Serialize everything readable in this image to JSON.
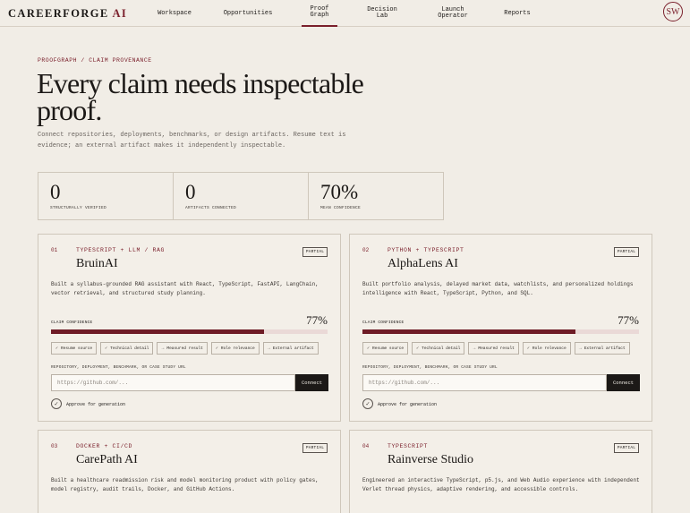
{
  "brand": {
    "name": "CAREERFORGE",
    "suffix": "AI"
  },
  "nav": {
    "items": [
      {
        "label": "Workspace",
        "active": false
      },
      {
        "label": "Opportunities",
        "active": false
      },
      {
        "label": "Proof\nGraph",
        "active": true
      },
      {
        "label": "Decision\nLab",
        "active": false
      },
      {
        "label": "Launch\nOperator",
        "active": false
      },
      {
        "label": "Reports",
        "active": false
      }
    ],
    "avatar": "SW"
  },
  "header": {
    "eyebrow": "PROOFGRAPH / CLAIM PROVENANCE",
    "title": "Every claim needs inspectable proof.",
    "subtitle": "Connect repositories, deployments, benchmarks, or design artifacts. Resume text is evidence; an external artifact makes it independently inspectable."
  },
  "stats": [
    {
      "value": "0",
      "label": "STRUCTURALLY VERIFIED"
    },
    {
      "value": "0",
      "label": "ARTIFACTS CONNECTED"
    },
    {
      "value": "70%",
      "label": "MEAN CONFIDENCE"
    }
  ],
  "cards": [
    {
      "num": "01",
      "stack": "TYPESCRIPT + LLM / RAG",
      "badge": "PARTIAL",
      "name": "BruinAI",
      "description": "Built a syllabus-grounded RAG assistant with React, TypeScript, FastAPI, LangChain, vector retrieval, and structured study planning.",
      "confidence_label": "CLAIM CONFIDENCE",
      "confidence": "77%",
      "confidence_fraction": 0.77,
      "chips": [
        {
          "icon": "check",
          "label": "Resume source"
        },
        {
          "icon": "check",
          "label": "Technical detail"
        },
        {
          "icon": "arrow",
          "label": "Measured result"
        },
        {
          "icon": "check",
          "label": "Role relevance"
        },
        {
          "icon": "arrow",
          "label": "External artifact"
        }
      ],
      "repo_label": "REPOSITORY, DEPLOYMENT, BENCHMARK, OR CASE STUDY URL",
      "repo_placeholder": "https://github.com/...",
      "connect_label": "Connect",
      "approve_label": "Approve for generation"
    },
    {
      "num": "02",
      "stack": "PYTHON + TYPESCRIPT",
      "badge": "PARTIAL",
      "name": "AlphaLens AI",
      "description": "Built portfolio analysis, delayed market data, watchlists, and personalized holdings intelligence with React, TypeScript, Python, and SQL.",
      "confidence_label": "CLAIM CONFIDENCE",
      "confidence": "77%",
      "confidence_fraction": 0.77,
      "chips": [
        {
          "icon": "check",
          "label": "Resume source"
        },
        {
          "icon": "check",
          "label": "Technical detail"
        },
        {
          "icon": "arrow",
          "label": "Measured result"
        },
        {
          "icon": "check",
          "label": "Role relevance"
        },
        {
          "icon": "arrow",
          "label": "External artifact"
        }
      ],
      "repo_label": "REPOSITORY, DEPLOYMENT, BENCHMARK, OR CASE STUDY URL",
      "repo_placeholder": "https://github.com/...",
      "connect_label": "Connect",
      "approve_label": "Approve for generation"
    },
    {
      "num": "03",
      "stack": "DOCKER + CI/CD",
      "badge": "PARTIAL",
      "name": "CarePath AI",
      "description": "Built a healthcare readmission risk and model monitoring product with policy gates, model registry, audit trails, Docker, and GitHub Actions."
    },
    {
      "num": "04",
      "stack": "TYPESCRIPT",
      "badge": "PARTIAL",
      "name": "Rainverse Studio",
      "description": "Engineered an interactive TypeScript, p5.js, and Web Audio experience with independent Verlet thread physics, adaptive rendering, and accessible controls."
    }
  ],
  "colors": {
    "accent": "#7a1f2b",
    "background": "#f1ede6",
    "bar_fill": "#6e1b26",
    "bar_track": "#ead9d7"
  }
}
